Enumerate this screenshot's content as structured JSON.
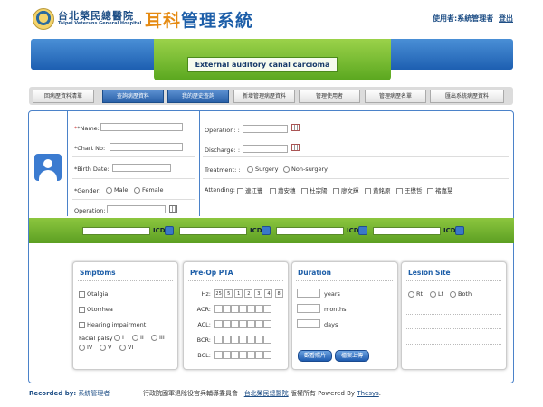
{
  "header": {
    "hospital_cn": "台北榮民總醫院",
    "hospital_en": "Taipei Veterans General Hospital",
    "system_prefix": "耳科",
    "system_suffix": "管理系統",
    "user_label": "使用者:系統管理者",
    "logout": "登出"
  },
  "banner": {
    "title": "External auditory canal carcioma"
  },
  "tabs": [
    "回病歷資料清單",
    "查詢病歷資料",
    "我的歷史查詢",
    "新增管理病歷資料",
    "管理使用者",
    "管理病歷名單",
    "匯出系統病歷資料"
  ],
  "patient": {
    "name_label": "*Name:",
    "chart_label": "*Chart No:",
    "birth_label": "*Birth Date:",
    "gender_label": "*Gender:",
    "gender_options": [
      "Male",
      "Female"
    ],
    "operation_label": "Operation:"
  },
  "surgery": {
    "operation_label": "Operation: :",
    "discharge_label": "Discharge: :",
    "treatment_label": "Treatment: :",
    "treatment_options": [
      "Surgery",
      "Non-surgery"
    ],
    "attending_label": "Attending:",
    "attendings": [
      "連江豐",
      "蕭安穗",
      "杜宗陽",
      "廖文輝",
      "黃銘原",
      "王懋哲",
      "褚嘉慧"
    ]
  },
  "icd": {
    "label": "ICD"
  },
  "symptoms": {
    "title": "Smptoms",
    "items": [
      "Otalgia",
      "Otorrhea",
      "Hearing impairment"
    ],
    "facial_label": "Facial palsy",
    "facial_options": [
      "I",
      "II",
      "III",
      "IV",
      "V",
      "VI"
    ]
  },
  "pta": {
    "title": "Pre-Op PTA",
    "hz_label": "Hz:",
    "freqs": [
      "25",
      "5",
      "1",
      "2",
      "3",
      "4",
      "8"
    ],
    "rows": [
      "ACR:",
      "ACL:",
      "BCR:",
      "BCL:"
    ]
  },
  "duration": {
    "title": "Duration",
    "units": [
      "years",
      "months",
      "days"
    ],
    "btn_view": "觀看照片",
    "btn_upload": "檔案上傳"
  },
  "lesion": {
    "title": "Lesion Site",
    "options": [
      "Rt",
      "Lt",
      "Both"
    ]
  },
  "footer": {
    "recorded_label": "Recorded by:",
    "recorded_value": "系統管理者",
    "credit_prefix": "行政院國軍退除役官兵輔導委員會 · ",
    "credit_link": "台北榮民總醫院",
    "credit_mid": " 版權所有 Powered By ",
    "credit_brand": "Thesys",
    "credit_end": "."
  }
}
